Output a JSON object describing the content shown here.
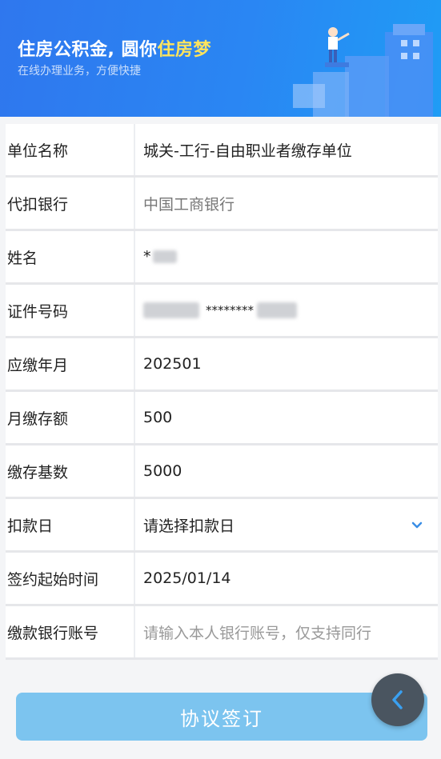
{
  "banner": {
    "title_prefix": "住房公积金, 圆你",
    "title_highlight": "住房梦",
    "subtitle": "在线办理业务，方便快捷"
  },
  "form": {
    "rows": [
      {
        "label": "单位名称",
        "value": "城关-工行-自由职业者缴存单位"
      },
      {
        "label": "代扣银行",
        "value": "中国工商银行"
      },
      {
        "label": "姓名",
        "value": "*"
      },
      {
        "label": "证件号码",
        "value": "********"
      },
      {
        "label": "应缴年月",
        "value": "202501"
      },
      {
        "label": "月缴存额",
        "value": "500"
      },
      {
        "label": "缴存基数",
        "value": "5000"
      },
      {
        "label": "扣款日",
        "value": "请选择扣款日"
      },
      {
        "label": "签约起始时间",
        "value": "2025/01/14"
      },
      {
        "label": "缴款银行账号",
        "placeholder": "请输入本人银行账号，仅支持同行"
      }
    ]
  },
  "submit_label": "协议签订",
  "icons": {
    "dropdown": "chevron-down-icon",
    "back": "chevron-left-icon"
  },
  "colors": {
    "banner": "#2f77ee",
    "highlight": "#ffe45c",
    "submit": "#7cc4ef",
    "accent": "#3a8ee6"
  }
}
